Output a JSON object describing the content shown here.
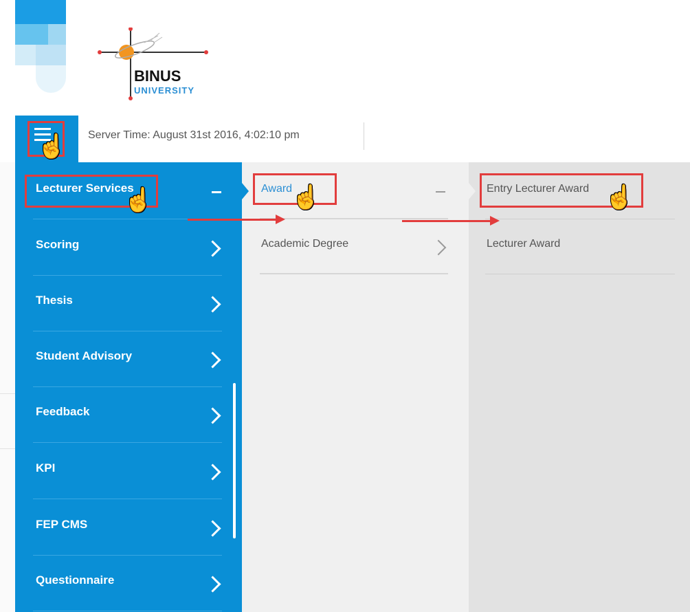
{
  "logo": {
    "name": "BINUS",
    "sub": "UNIVERSITY"
  },
  "topbar": {
    "menu_icon": "hamburger-icon",
    "server_time": "Server Time: August 31st 2016, 4:02:10 pm"
  },
  "menu_level1": [
    {
      "label": "Lecturer Services",
      "state": "expanded",
      "indicator": "minus"
    },
    {
      "label": "Scoring",
      "indicator": "chevron-right"
    },
    {
      "label": "Thesis",
      "indicator": "chevron-right"
    },
    {
      "label": "Student Advisory",
      "indicator": "chevron-right"
    },
    {
      "label": "Feedback",
      "indicator": "chevron-right"
    },
    {
      "label": "KPI",
      "indicator": "chevron-right"
    },
    {
      "label": "FEP CMS",
      "indicator": "chevron-right"
    },
    {
      "label": "Questionnaire",
      "indicator": "chevron-right"
    }
  ],
  "menu_level2": [
    {
      "label": "Award",
      "state": "expanded",
      "indicator": "minus"
    },
    {
      "label": "Academic Degree",
      "indicator": "chevron-right"
    }
  ],
  "menu_level3": [
    {
      "label": "Entry Lecturer Award"
    },
    {
      "label": "Lecturer Award"
    }
  ],
  "colors": {
    "primary": "#0a8fd6",
    "annotation": "#e23d3d",
    "panel2": "#f0f0f0",
    "panel3": "#e2e2e2",
    "link": "#2b8fd4"
  },
  "annotation": {
    "cursor_icon": "hand-pointer-icon"
  }
}
